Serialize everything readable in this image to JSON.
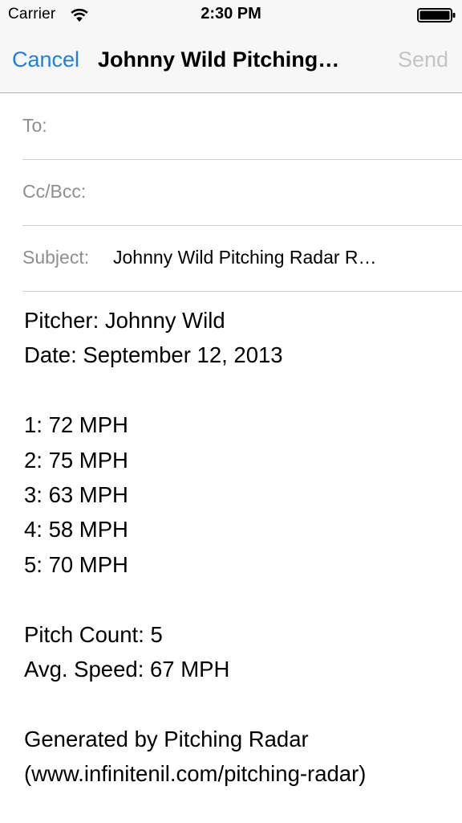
{
  "status_bar": {
    "carrier": "Carrier",
    "time": "2:30 PM",
    "wifi_icon": "wifi-icon",
    "battery_icon": "battery-icon"
  },
  "nav": {
    "cancel_label": "Cancel",
    "title": "Johnny Wild Pitching…",
    "send_label": "Send",
    "accent_color": "#1a7ef5",
    "disabled_color": "#c4c4c4"
  },
  "fields": {
    "to_label": "To:",
    "to_value": "",
    "cc_label": "Cc/Bcc:",
    "cc_value": "",
    "subject_label": "Subject:",
    "subject_value": "Johnny Wild Pitching Radar R…"
  },
  "body": {
    "lines": [
      "Pitcher: Johnny Wild",
      "Date: September 12, 2013",
      "",
      "1: 72 MPH",
      "2: 75 MPH",
      "3: 63 MPH",
      "4: 58 MPH",
      "5: 70 MPH",
      "",
      "Pitch Count: 5",
      "Avg. Speed: 67 MPH",
      "",
      "Generated by Pitching Radar",
      "(www.infinitenil.com/pitching-radar)"
    ]
  }
}
